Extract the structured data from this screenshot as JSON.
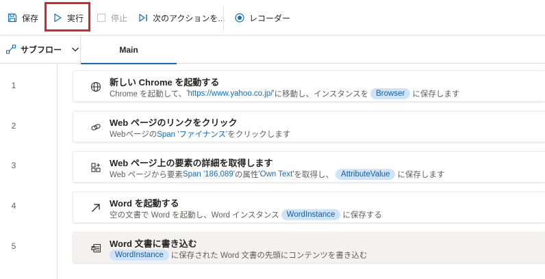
{
  "toolbar": {
    "save_label": "保存",
    "run_label": "実行",
    "stop_label": "停止",
    "next_action_label": "次のアクションを...",
    "recorder_label": "レコーダー"
  },
  "tabs": {
    "subflow_label": "サブフロー",
    "main_label": "Main"
  },
  "steps": [
    {
      "line": "1",
      "icon": "globe-icon",
      "title": "新しい Chrome を起動する",
      "desc": {
        "p1": "Chrome を起動して、",
        "url": "'https://www.yahoo.co.jp/'",
        "p2": " に移動し、インスタンスを",
        "var": "Browser",
        "p3": "に保存します"
      }
    },
    {
      "line": "2",
      "icon": "link-icon",
      "title": "Web ページのリンクをクリック",
      "desc": {
        "p1": "Webページの ",
        "target": "Span 'ファイナンス'",
        "p2": " をクリックします"
      }
    },
    {
      "line": "3",
      "icon": "element-details-icon",
      "title": "Web ページ上の要素の詳細を取得します",
      "desc": {
        "p1": "Web ページから要素 ",
        "target": "Span '186,089'",
        "p2": " の属性 ",
        "attr": "'Own Text'",
        "p3": " を取得し、",
        "var": "AttributeValue",
        "p4": "に保存します"
      }
    },
    {
      "line": "4",
      "icon": "launch-arrow-icon",
      "title": "Word を起動する",
      "desc": {
        "p1": "空の文書で Word を起動し、Word インスタンス",
        "var": "WordInstance",
        "p2": "に保存する"
      }
    },
    {
      "line": "5",
      "icon": "word-document-icon",
      "title": "Word 文書に書き込む",
      "desc": {
        "var": "WordInstance",
        "p1": "に保存された Word 文書の先頭にコンテンツを書き込む"
      }
    }
  ],
  "colors": {
    "accent": "#0f6cbd",
    "highlight": "#e01f26",
    "chip_bg": "#cfe4fa"
  }
}
